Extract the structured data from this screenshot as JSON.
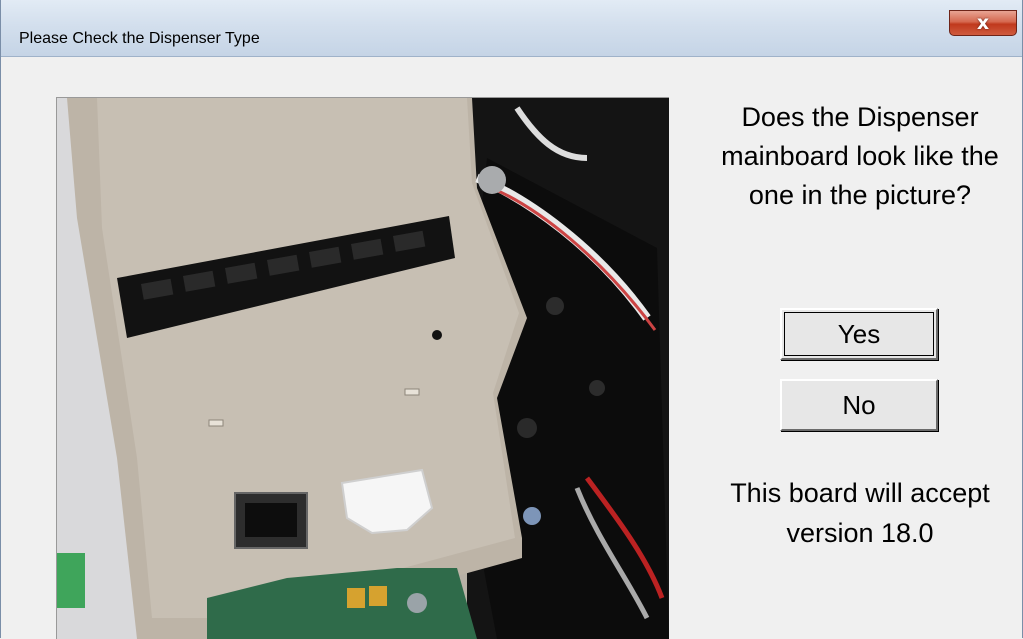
{
  "window": {
    "title": "Please Check the Dispenser Type",
    "close_glyph": "x"
  },
  "photo": {
    "subject": "dispenser mainboard"
  },
  "prompt": {
    "question": "Does the Dispenser mainboard look like the one in the picture?",
    "yes_label": "Yes",
    "no_label": "No",
    "info": "This board will accept version 18.0"
  },
  "colors": {
    "titlebar": "#d3dfed",
    "close_button": "#c0391d",
    "client_bg": "#f0f0f0",
    "button_face": "#e7e7e7"
  }
}
